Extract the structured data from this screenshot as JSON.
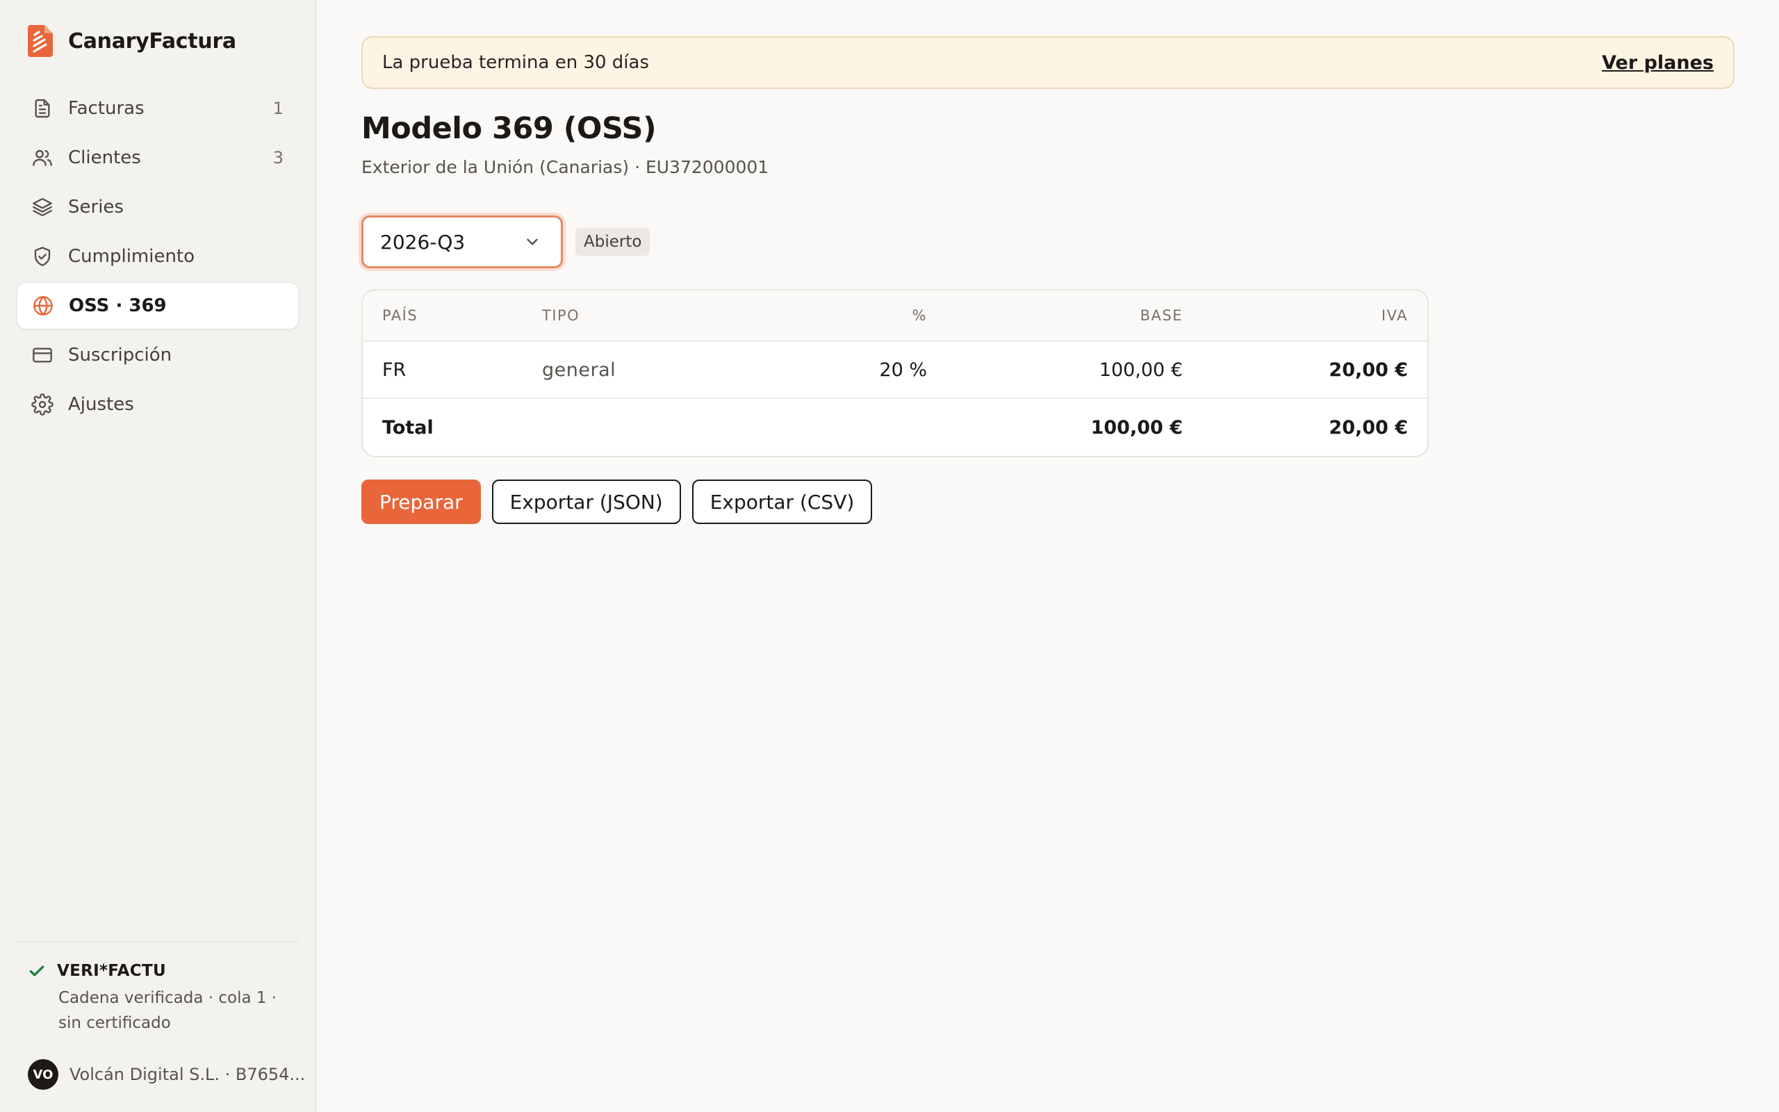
{
  "app": {
    "name": "CanaryFactura",
    "accent_color": "#e8663a"
  },
  "sidebar": {
    "items": [
      {
        "label": "Facturas",
        "count": "1",
        "icon": "document-icon"
      },
      {
        "label": "Clientes",
        "count": "3",
        "icon": "users-icon"
      },
      {
        "label": "Series",
        "count": "",
        "icon": "layers-icon"
      },
      {
        "label": "Cumplimiento",
        "count": "",
        "icon": "shield-check-icon"
      },
      {
        "label": "OSS · 369",
        "count": "",
        "icon": "globe-icon",
        "active": true
      },
      {
        "label": "Suscripción",
        "count": "",
        "icon": "credit-card-icon"
      },
      {
        "label": "Ajustes",
        "count": "",
        "icon": "gear-icon"
      }
    ],
    "verifactu": {
      "title": "VERI*FACTU",
      "status": "Cadena verificada · cola 1 · sin certificado",
      "status_color": "#16803c"
    },
    "company": {
      "initials": "VO",
      "name": "Volcán Digital S.L. · B7654..."
    }
  },
  "trial_banner": {
    "text": "La prueba termina en 30 días",
    "link": "Ver planes"
  },
  "page": {
    "title": "Modelo 369 (OSS)",
    "subtitle": "Exterior de la Unión (Canarias) · EU372000001"
  },
  "period": {
    "selected": "2026-Q3",
    "status": "Abierto"
  },
  "table": {
    "headers": {
      "country": "PAÍS",
      "type": "TIPO",
      "rate": "%",
      "base": "BASE",
      "vat": "IVA"
    },
    "rows": [
      {
        "country": "FR",
        "type": "general",
        "rate": "20 %",
        "base": "100,00 €",
        "vat": "20,00 €"
      }
    ],
    "total": {
      "label": "Total",
      "base": "100,00 €",
      "vat": "20,00 €"
    }
  },
  "actions": {
    "prepare": "Preparar",
    "export_json": "Exportar (JSON)",
    "export_csv": "Exportar (CSV)"
  }
}
